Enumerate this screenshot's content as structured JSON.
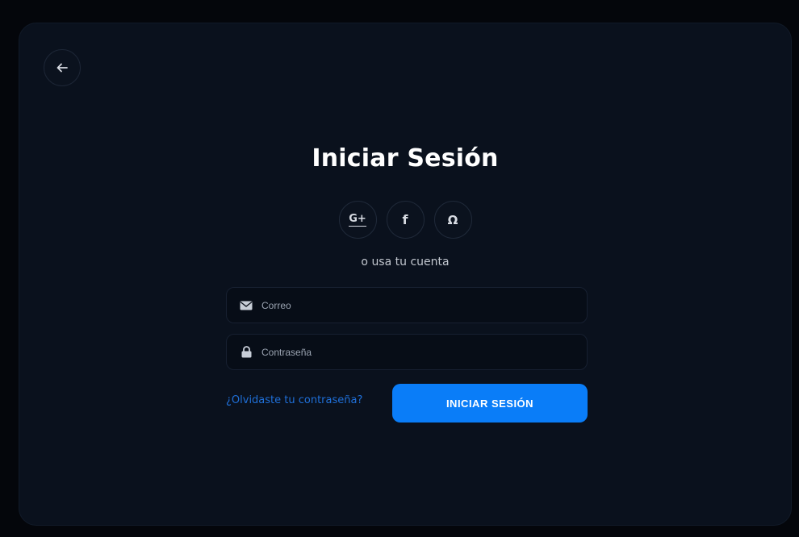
{
  "colors": {
    "page_background": "#04060b",
    "card_background": "#0a111d",
    "input_background": "#070d17",
    "accent": "#0a7df8",
    "link": "#1f6fd8",
    "text_primary": "#ffffff",
    "text_secondary": "#c2c7cf"
  },
  "nav": {
    "back_icon": "arrow-left-icon"
  },
  "login": {
    "title": "Iniciar Sesión",
    "socials": [
      {
        "icon": "google-plus-icon",
        "glyph": "G+"
      },
      {
        "icon": "facebook-icon",
        "glyph": "f"
      },
      {
        "icon": "github-icon",
        "glyph": "Ω"
      }
    ],
    "alt_text": "o usa tu cuenta",
    "email": {
      "icon": "envelope-icon",
      "placeholder": "Correo",
      "value": ""
    },
    "password": {
      "icon": "lock-icon",
      "placeholder": "Contraseña",
      "value": ""
    },
    "forgot_link": "¿Olvidaste tu contraseña?",
    "submit_label": "INICIAR SESIÓN"
  }
}
